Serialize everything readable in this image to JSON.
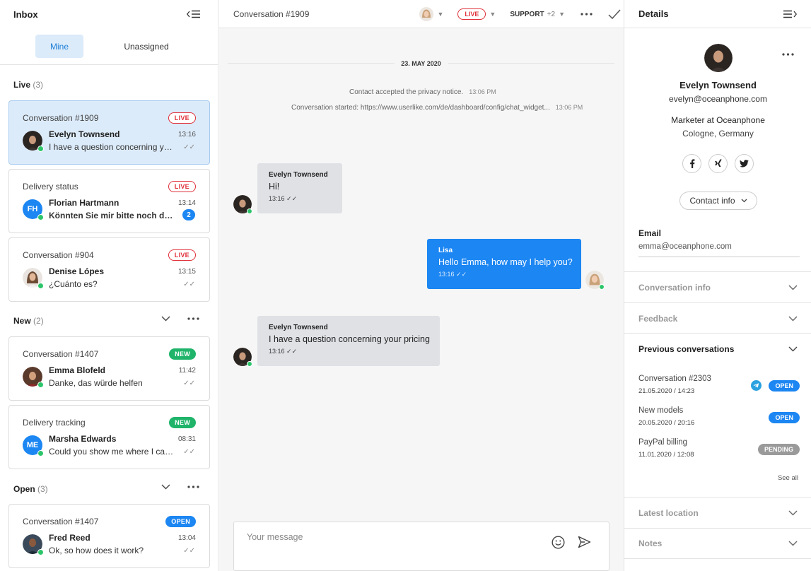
{
  "left": {
    "title": "Inbox",
    "tabs": [
      "Mine",
      "Unassigned"
    ],
    "sections": {
      "live": {
        "label": "Live",
        "count": "(3)"
      },
      "new": {
        "label": "New",
        "count": "(2)"
      },
      "open": {
        "label": "Open",
        "count": "(3)"
      }
    },
    "cards": [
      {
        "title": "Conversation #1909",
        "badge": "LIVE",
        "name": "Evelyn Townsend",
        "message": "I have a question concerning your pricing",
        "time": "13:16",
        "ticks": "✓✓"
      },
      {
        "title": "Delivery status",
        "badge": "LIVE",
        "initials": "FH",
        "name": "Florian Hartmann",
        "message": "Könnten Sie mir bitte noch die Bestellnummer nennen?",
        "time": "13:14",
        "unread": "2"
      },
      {
        "title": "Conversation #904",
        "badge": "LIVE",
        "name": "Denise Lópes",
        "message": "¿Cuánto es?",
        "time": "13:15",
        "ticks": "✓✓"
      },
      {
        "title": "Conversation #1407",
        "badge": "NEW",
        "name": "Emma Blofeld",
        "message": "Danke, das würde helfen",
        "time": "11:42",
        "ticks": "✓✓"
      },
      {
        "title": "Delivery tracking",
        "badge": "NEW",
        "initials": "ME",
        "name": "Marsha Edwards",
        "message": "Could you show me where I can track my order?",
        "time": "08:31",
        "ticks": "✓✓"
      },
      {
        "title": "Conversation #1407",
        "badge": "OPEN",
        "name": "Fred Reed",
        "message": "Ok, so how does it work?",
        "time": "13:04",
        "ticks": "✓✓"
      }
    ]
  },
  "middle": {
    "title": "Conversation #1909",
    "status": "LIVE",
    "team": "SUPPORT",
    "team_extra": "+2",
    "date": "23. MAY 2020",
    "system": [
      {
        "text": "Contact accepted the privacy notice.",
        "time": "13:06 PM"
      },
      {
        "text": "Conversation started: https://www.userlike.com/de/dashboard/config/chat_widget...",
        "time": "13:06 PM"
      }
    ],
    "messages": [
      {
        "who": "Evelyn Townsend",
        "text": "Hi!",
        "time": "13:16"
      },
      {
        "who": "Lisa",
        "text": "Hello Emma, how may I help you?",
        "time": "13:16"
      },
      {
        "who": "Evelyn Townsend",
        "text": "I have a question concerning your pricing",
        "time": "13:16"
      }
    ],
    "composer_placeholder": "Your message"
  },
  "right": {
    "title": "Details",
    "name": "Evelyn Townsend",
    "email": "evelyn@oceanphone.com",
    "role": "Marketer at Oceanphone",
    "location": "Cologne, Germany",
    "social": [
      "f",
      "x",
      "t"
    ],
    "contact_info_label": "Contact info",
    "email_label": "Email",
    "email_value": "emma@oceanphone.com",
    "sections": [
      "Conversation info",
      "Feedback",
      "Previous conversations",
      "Latest location",
      "Notes"
    ],
    "previous": [
      {
        "title": "Conversation #2303",
        "date": "21.05.2020 / 14:23",
        "status": "OPEN"
      },
      {
        "title": "New models",
        "date": "20.05.2020 / 20:16",
        "status": "OPEN"
      },
      {
        "title": "PayPal billing",
        "date": "11.01.2020 / 12:08",
        "status": "PENDING"
      }
    ],
    "see_all": "See all"
  },
  "colors": {
    "accent": "#1c86f2",
    "live": "#e0303a",
    "new": "#1fb46a",
    "pending": "#9a9a9a",
    "online": "#2dc56a",
    "selected": "#dcebfa"
  }
}
